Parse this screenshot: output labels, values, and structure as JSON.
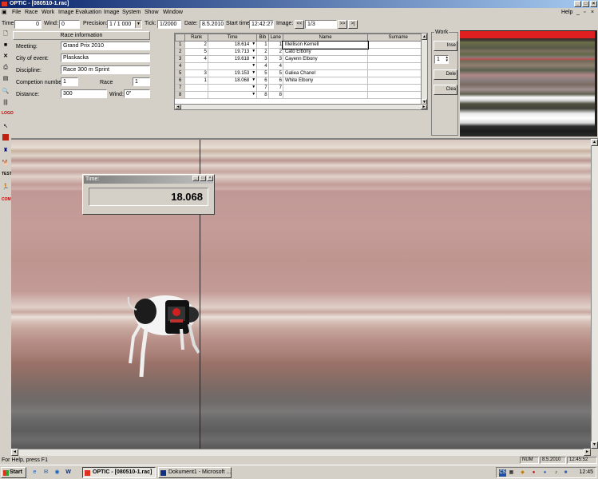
{
  "window": {
    "title": "OPTIC - [080510-1.rac]"
  },
  "menu": {
    "items": [
      "File",
      "Race",
      "Work",
      "Image Evaluation",
      "Image",
      "System",
      "Show",
      "Window"
    ],
    "help": "Help"
  },
  "toolbar": {
    "time_label": "Time:",
    "time_value": "0",
    "wind_label": "Wind:",
    "wind_value": "0",
    "precision_label": "Precision:",
    "precision_value": "1 / 1 000",
    "tick_label": "Tick:",
    "tick_value": "1/2000",
    "date_label": "Date:",
    "date_value": "8.5.2010",
    "start_label": "Start time",
    "start_value": "12:42:27",
    "image_label": "Image:",
    "prev": "<<",
    "image_value": "1/3",
    "next": ">>",
    "end": ">|"
  },
  "race_info": {
    "header": "Race information",
    "meeting_label": "Meeting:",
    "meeting": "Grand Prix 2010",
    "city_label": "City of event:",
    "city": "Plaskacka",
    "discipline_label": "Discipline:",
    "discipline": "Race 300 m Sprint",
    "competition_label": "Competion number:",
    "competition": "1",
    "race_label": "Race",
    "race": "1",
    "distance_label": "Distance:",
    "distance": "300",
    "wind_label": "Wind:",
    "wind": "0\""
  },
  "results": {
    "columns": [
      "",
      "Rank",
      "Time",
      "Bib",
      "Lane",
      "Name",
      "Surname"
    ],
    "rows": [
      {
        "n": "1",
        "rank": "2",
        "time": "18.614",
        "bib": "1",
        "lane": "1",
        "name": "Mellison Kernell",
        "surname": ""
      },
      {
        "n": "2",
        "rank": "5",
        "time": "19.713",
        "bib": "2",
        "lane": "2",
        "name": "Cato Elbony",
        "surname": ""
      },
      {
        "n": "3",
        "rank": "4",
        "time": "19.618",
        "bib": "3",
        "lane": "3",
        "name": "Cayenn Elbony",
        "surname": ""
      },
      {
        "n": "4",
        "rank": "",
        "time": "",
        "bib": "4",
        "lane": "4",
        "name": "",
        "surname": ""
      },
      {
        "n": "5",
        "rank": "3",
        "time": "19.153",
        "bib": "5",
        "lane": "5",
        "name": "Galiea Chanel",
        "surname": ""
      },
      {
        "n": "6",
        "rank": "1",
        "time": "18.068",
        "bib": "6",
        "lane": "6",
        "name": "White Elbony",
        "surname": ""
      },
      {
        "n": "7",
        "rank": "",
        "time": "",
        "bib": "7",
        "lane": "7",
        "name": "",
        "surname": ""
      },
      {
        "n": "8",
        "rank": "",
        "time": "",
        "bib": "8",
        "lane": "8",
        "name": "",
        "surname": ""
      }
    ]
  },
  "work": {
    "label": "Work",
    "btn1": "Inse",
    "spin_value": "1",
    "btn2": "Dele",
    "btn3": "Clea"
  },
  "time_window": {
    "title": "Time:",
    "value": "18.068"
  },
  "status": {
    "help": "For Help, press F1",
    "num": "NUM",
    "date": "8.5.2010",
    "time": "12:45:52"
  },
  "taskbar": {
    "start": "Start",
    "items": [
      "OPTIC - [080510-1.rac]",
      "Dokument1 - Microsoft ..."
    ],
    "clock": "12:45"
  },
  "left_tools": [
    "new-file-icon",
    "save-icon",
    "delete-icon",
    "print-icon",
    "preview-icon",
    "zoom-icon",
    "barcode-icon",
    "logo-icon",
    "pointer-icon",
    "red-square-icon",
    "bag-icon",
    "greyhound-icon",
    "test-icon",
    "runner-icon",
    "com-icon"
  ],
  "colors": {
    "title_active": "#0a246a",
    "thumb_red": "#e02020",
    "finish_line": "#2a2020"
  }
}
